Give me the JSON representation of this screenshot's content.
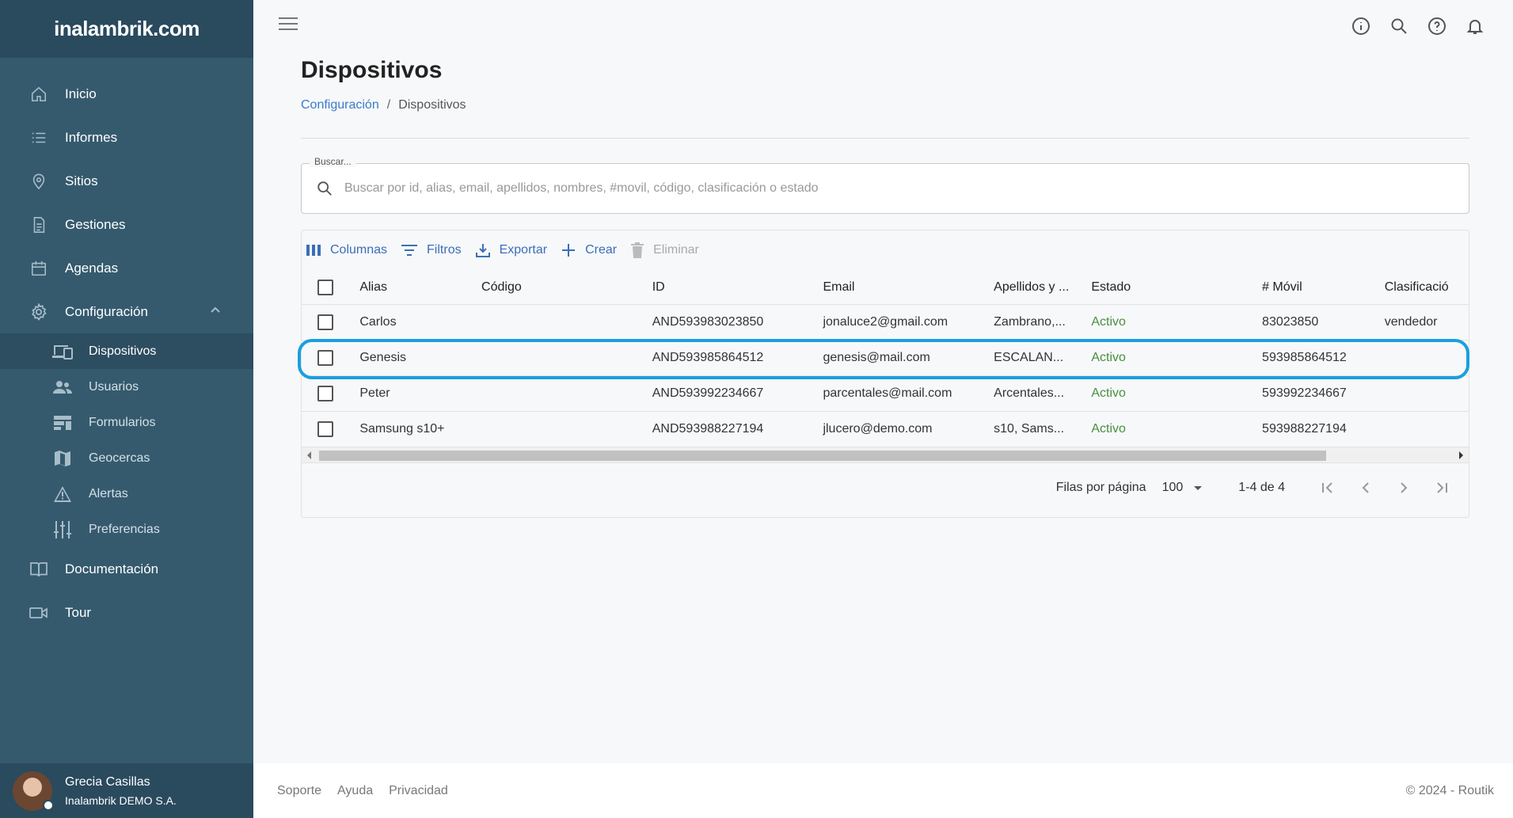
{
  "brand": {
    "logo_text": "inalambrik.com"
  },
  "sidebar": {
    "items": [
      {
        "label": "Inicio",
        "icon": "home-icon"
      },
      {
        "label": "Informes",
        "icon": "list-icon"
      },
      {
        "label": "Sitios",
        "icon": "location-icon"
      },
      {
        "label": "Gestiones",
        "icon": "document-icon"
      },
      {
        "label": "Agendas",
        "icon": "calendar-icon"
      },
      {
        "label": "Configuración",
        "icon": "gear-icon"
      }
    ],
    "sub_items": [
      {
        "label": "Dispositivos",
        "icon": "devices-icon",
        "active": true
      },
      {
        "label": "Usuarios",
        "icon": "users-icon"
      },
      {
        "label": "Formularios",
        "icon": "forms-icon"
      },
      {
        "label": "Geocercas",
        "icon": "map-icon"
      },
      {
        "label": "Alertas",
        "icon": "warning-icon"
      },
      {
        "label": "Preferencias",
        "icon": "sliders-icon"
      }
    ],
    "bottom_items": [
      {
        "label": "Documentación",
        "icon": "book-icon"
      },
      {
        "label": "Tour",
        "icon": "video-icon"
      }
    ],
    "user": {
      "name": "Grecia Casillas",
      "org": "Inalambrik DEMO S.A."
    }
  },
  "header": {
    "icons": [
      "info-icon",
      "search-icon",
      "help-icon",
      "bell-icon"
    ]
  },
  "page": {
    "title": "Dispositivos",
    "breadcrumb": {
      "parent": "Configuración",
      "current": "Dispositivos",
      "separator": "/"
    }
  },
  "search": {
    "label": "Buscar...",
    "placeholder": "Buscar por id, alias, email, apellidos, nombres, #movil, código, clasificación o estado",
    "value": ""
  },
  "toolbar": {
    "columns": "Columnas",
    "filters": "Filtros",
    "export": "Exportar",
    "create": "Crear",
    "delete": "Eliminar"
  },
  "table": {
    "headers": {
      "alias": "Alias",
      "codigo": "Código",
      "id": "ID",
      "email": "Email",
      "apellidos": "Apellidos y ...",
      "estado": "Estado",
      "movil": "# Móvil",
      "clasif": "Clasificació"
    },
    "rows": [
      {
        "alias": "Carlos",
        "codigo": "",
        "id": "AND593983023850",
        "email": "jonaluce2@gmail.com",
        "apellidos": "Zambrano,...",
        "estado": "Activo",
        "movil": "83023850",
        "clasif": "vendedor"
      },
      {
        "alias": "Genesis",
        "codigo": "",
        "id": "AND593985864512",
        "email": "genesis@mail.com",
        "apellidos": "ESCALAN...",
        "estado": "Activo",
        "movil": "593985864512",
        "clasif": ""
      },
      {
        "alias": "Peter",
        "codigo": "",
        "id": "AND593992234667",
        "email": "parcentales@mail.com",
        "apellidos": "Arcentales...",
        "estado": "Activo",
        "movil": "593992234667",
        "clasif": ""
      },
      {
        "alias": "Samsung s10+",
        "codigo": "",
        "id": "AND593988227194",
        "email": "jlucero@demo.com",
        "apellidos": "s10, Sams...",
        "estado": "Activo",
        "movil": "593988227194",
        "clasif": ""
      }
    ]
  },
  "pagination": {
    "rows_per_page_label": "Filas por página",
    "rows_per_page": "100",
    "range": "1-4 de 4"
  },
  "footer": {
    "links": [
      "Soporte",
      "Ayuda",
      "Privacidad"
    ],
    "copyright": "© 2024 - Routik"
  },
  "colors": {
    "sidebar": "#355a6e",
    "accent": "#3a7bc8",
    "status_active": "#4a8f3e",
    "highlight": "#1a9fdf"
  }
}
